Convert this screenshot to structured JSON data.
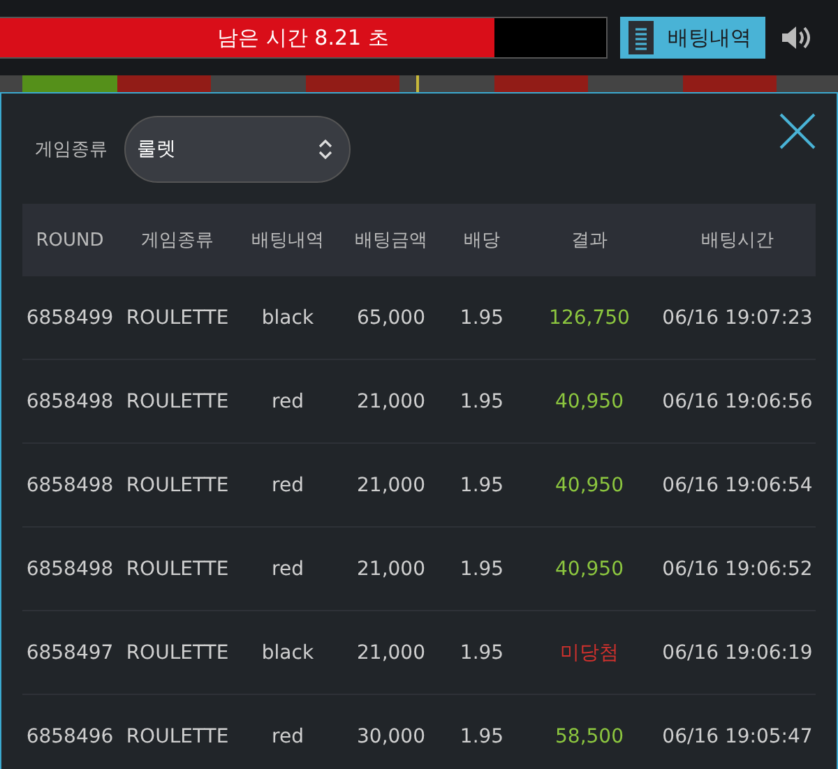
{
  "timer": {
    "text": "남은 시간 8.21 초",
    "level": 0.816
  },
  "history_button": {
    "label": "배팅내역"
  },
  "history_strip": [
    {
      "color": "#444444"
    },
    {
      "color": "#55901a"
    },
    {
      "color": "#921c17"
    },
    {
      "color": "#444444"
    },
    {
      "color": "#921c17"
    },
    {
      "color": "#444444"
    },
    {
      "color": "#921c17"
    },
    {
      "color": "#444444"
    },
    {
      "color": "#921c17"
    },
    {
      "color": "#444444"
    }
  ],
  "filter": {
    "label": "게임종류",
    "value": "룰렛"
  },
  "table": {
    "columns": [
      "ROUND",
      "게임종류",
      "배팅내역",
      "배팅금액",
      "배당",
      "결과",
      "배팅시간"
    ],
    "rows": [
      {
        "cells": [
          "6858499",
          "ROULETTE",
          "black",
          "65,000",
          "1.95",
          "126,750",
          "06/16 19:07:23"
        ],
        "color": "#8cc63f"
      },
      {
        "cells": [
          "6858498",
          "ROULETTE",
          "red",
          "21,000",
          "1.95",
          "40,950",
          "06/16 19:06:56"
        ],
        "color": "#8cc63f"
      },
      {
        "cells": [
          "6858498",
          "ROULETTE",
          "red",
          "21,000",
          "1.95",
          "40,950",
          "06/16 19:06:54"
        ],
        "color": "#8cc63f"
      },
      {
        "cells": [
          "6858498",
          "ROULETTE",
          "red",
          "21,000",
          "1.95",
          "40,950",
          "06/16 19:06:52"
        ],
        "color": "#8cc63f"
      },
      {
        "cells": [
          "6858497",
          "ROULETTE",
          "black",
          "21,000",
          "1.95",
          "미당첨",
          "06/16 19:06:19"
        ],
        "color": "#d0312d"
      },
      {
        "cells": [
          "6858496",
          "ROULETTE",
          "red",
          "30,000",
          "1.95",
          "58,500",
          "06/16 19:05:47"
        ],
        "color": "#8cc63f"
      }
    ]
  }
}
